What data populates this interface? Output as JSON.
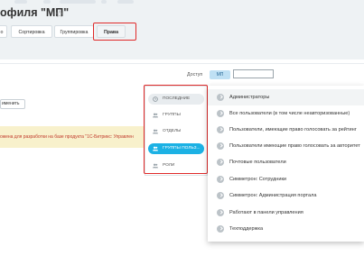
{
  "header": {
    "title": "офиля \"МП\"",
    "star_icon": "star-outline-icon"
  },
  "tabs": [
    {
      "label": "о",
      "active": false
    },
    {
      "label": "Сортировка",
      "active": false
    },
    {
      "label": "Группировка",
      "active": false
    },
    {
      "label": "Права",
      "active": true
    }
  ],
  "access": {
    "label": "Доступ",
    "chip": "МП",
    "input_value": ""
  },
  "apply_button": {
    "label": "именить"
  },
  "notice": {
    "text": "ожена для разработки на базе продукта \"1С-Битрикс: Управлен"
  },
  "picker": {
    "categories": [
      {
        "label": "последние",
        "icon": "clock-icon",
        "state": "hover"
      },
      {
        "label": "группы",
        "icon": "users-icon",
        "state": "normal"
      },
      {
        "label": "отделы",
        "icon": "users-icon",
        "state": "normal"
      },
      {
        "label": "группы польз...",
        "icon": "users-icon",
        "state": "active"
      },
      {
        "label": "роли",
        "icon": "users-icon",
        "state": "normal"
      }
    ],
    "items": [
      "Администраторы",
      "Все пользователи (в том числе неавторизованные)",
      "Пользователи, имеющие право голосовать за рейтинг",
      "Пользователи имеющие право голосовать за авторитет",
      "Почтовые пользователи",
      "Симметрон: Сотрудники",
      "Симметрон: Администрация портала",
      "Работают в панели управления",
      "Техподдержка"
    ]
  },
  "colors": {
    "accent": "#1cb1e4",
    "highlight_frame": "#e02a2a",
    "notice_bg": "#f8f1cc",
    "notice_text": "#c0392b"
  }
}
